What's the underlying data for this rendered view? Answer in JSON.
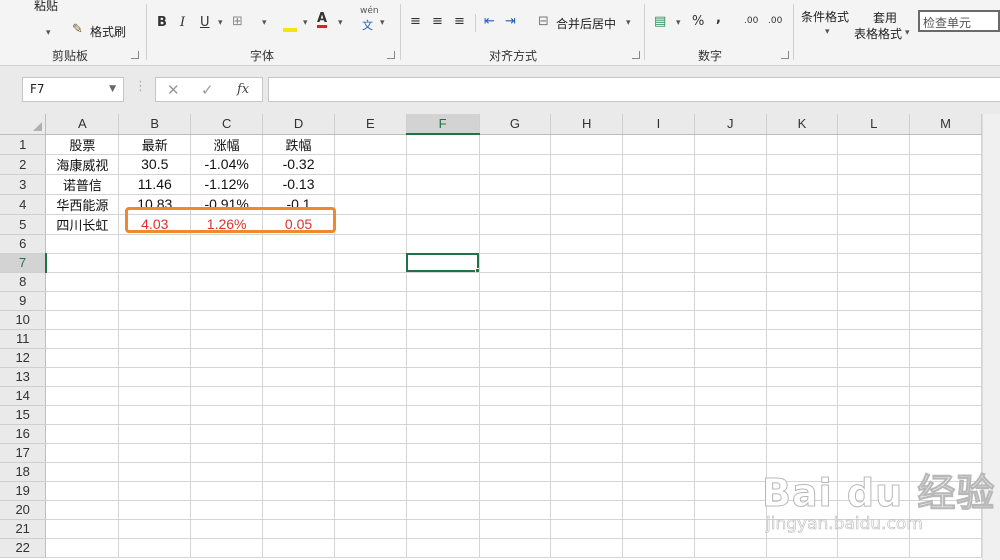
{
  "ribbon": {
    "clipboard": {
      "paste_label": "粘贴",
      "format_painter_label": "格式刷",
      "group_label": "剪贴板"
    },
    "font": {
      "bold": "B",
      "italic": "I",
      "underline": "U",
      "font_color_glyph": "A",
      "wen_glyph": "wén",
      "wen_char": "文",
      "group_label": "字体"
    },
    "alignment": {
      "merge_center_label": "合并后居中",
      "group_label": "对齐方式"
    },
    "number": {
      "percent": "%",
      "comma": ",",
      "increase_decimal": ".00",
      "decrease_decimal": ".00",
      "group_label": "数字"
    },
    "styles": {
      "conditional_format_label": "条件格式",
      "table_format_top": "套用",
      "table_format_label": "表格格式",
      "cell_styles_label": "检查单元"
    }
  },
  "formula_bar": {
    "name_box": "F7",
    "fx": "fx",
    "value": ""
  },
  "columns": [
    "A",
    "B",
    "C",
    "D",
    "E",
    "F",
    "G",
    "H",
    "I",
    "J",
    "K",
    "L",
    "M"
  ],
  "active_cell": "F7",
  "sheet_rows": [
    [
      "股票",
      "最新",
      "涨幅",
      "跌幅"
    ],
    [
      "海康威视",
      "30.5",
      "-1.04%",
      "-0.32"
    ],
    [
      "诺普信",
      "11.46",
      "-1.12%",
      "-0.13"
    ],
    [
      "华西能源",
      "10.83",
      "-0.91%",
      "-0.1"
    ],
    [
      "四川长虹",
      "4.03",
      "1.26%",
      "0.05"
    ]
  ],
  "highlighted_row": 5,
  "row_count": 22,
  "colors": {
    "accent_green": "#217346",
    "highlight_orange": "#f0882d",
    "value_red": "#e0312f"
  },
  "watermark": {
    "logo": "Bai du 经验",
    "url": "jingyan.baidu.com"
  }
}
